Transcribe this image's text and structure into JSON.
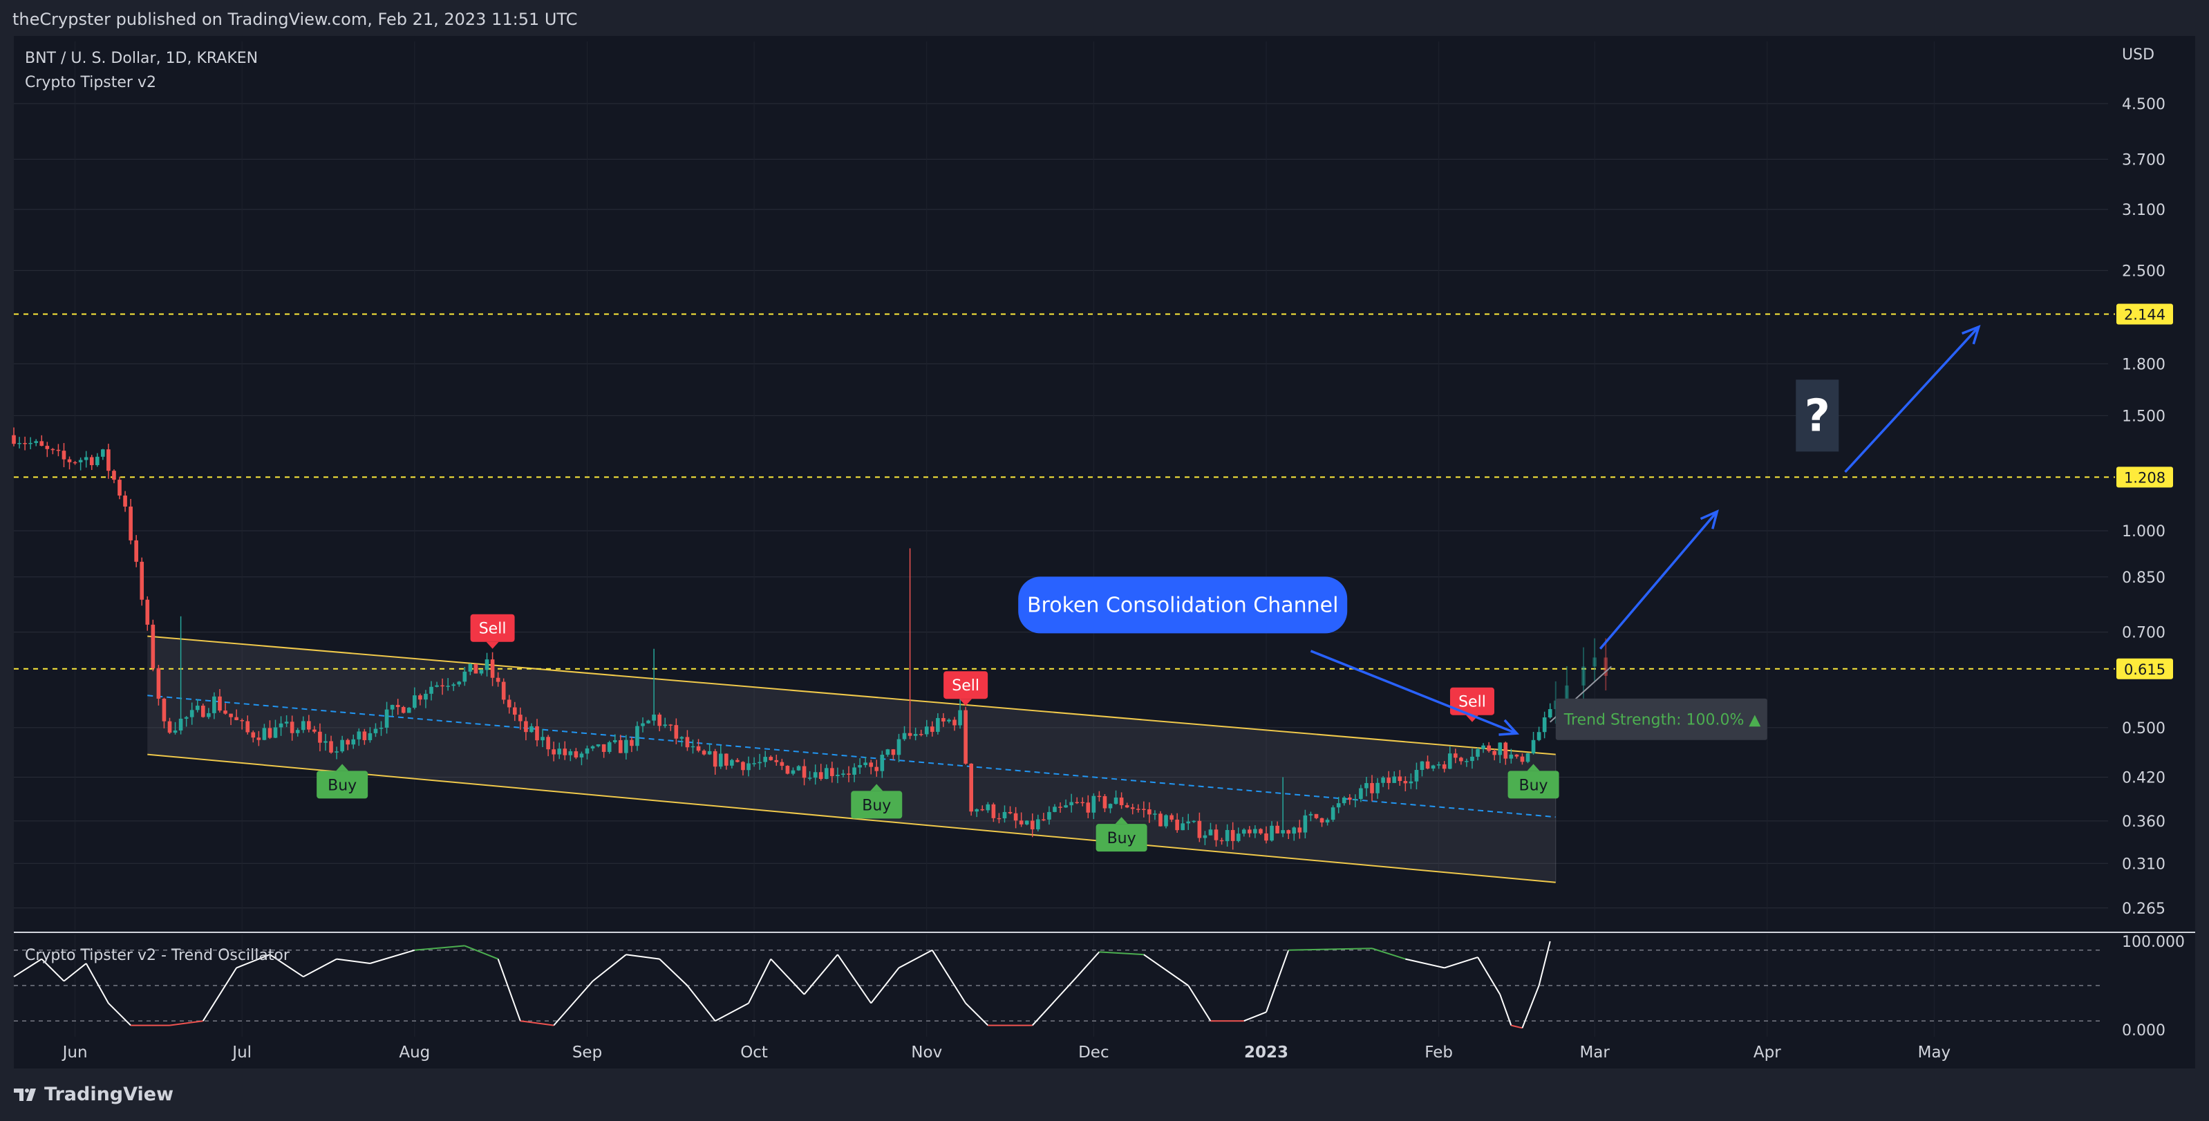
{
  "header": {
    "published_text": "theCrypster published on TradingView.com, Feb 21, 2023 11:51 UTC"
  },
  "footer": {
    "brand": "TradingView"
  },
  "colors": {
    "up": "#26a69a",
    "down": "#ef5350",
    "channel": "#f0c94b",
    "level": "#ffeb3b",
    "arrow": "#2962ff",
    "buy": "#4caf50",
    "sell": "#f23645",
    "osc_up": "#4caf50",
    "osc_down": "#ef5350",
    "osc_mid": "#ffffff"
  },
  "chart_data": {
    "type": "candlestick",
    "symbol_line": "BNT / U. S. Dollar, 1D, KRAKEN",
    "indicator_line": "Crypto Tipster v2",
    "currency": "USD",
    "y_scale": "log",
    "ylim": [
      0.245,
      5.6
    ],
    "y_ticks": [
      "4.500",
      "3.700",
      "3.100",
      "2.500",
      "1.800",
      "1.500",
      "1.000",
      "0.850",
      "0.700",
      "0.500",
      "0.420",
      "0.360",
      "0.310",
      "0.265"
    ],
    "x_ticks": [
      {
        "label": "Jun",
        "date": "2022-06-01"
      },
      {
        "label": "Jul",
        "date": "2022-07-01"
      },
      {
        "label": "Aug",
        "date": "2022-08-01"
      },
      {
        "label": "Sep",
        "date": "2022-09-01"
      },
      {
        "label": "Oct",
        "date": "2022-10-01"
      },
      {
        "label": "Nov",
        "date": "2022-11-01"
      },
      {
        "label": "Dec",
        "date": "2022-12-01"
      },
      {
        "label": "2023",
        "date": "2023-01-01",
        "bold": true
      },
      {
        "label": "Feb",
        "date": "2023-02-01"
      },
      {
        "label": "Mar",
        "date": "2023-03-01"
      },
      {
        "label": "Apr",
        "date": "2023-04-01"
      },
      {
        "label": "May",
        "date": "2023-05-01"
      }
    ],
    "x_range": [
      "2022-05-21",
      "2023-05-31"
    ],
    "price_key_points": [
      [
        "2022-05-21",
        1.4
      ],
      [
        "2022-05-30",
        1.28
      ],
      [
        "2022-06-06",
        1.3
      ],
      [
        "2022-06-10",
        1.1
      ],
      [
        "2022-06-14",
        0.7
      ],
      [
        "2022-06-17",
        0.5
      ],
      [
        "2022-06-22",
        0.52
      ],
      [
        "2022-06-26",
        0.55
      ],
      [
        "2022-07-02",
        0.49
      ],
      [
        "2022-07-12",
        0.5
      ],
      [
        "2022-07-18",
        0.46
      ],
      [
        "2022-07-27",
        0.52
      ],
      [
        "2022-08-04",
        0.58
      ],
      [
        "2022-08-14",
        0.62
      ],
      [
        "2022-08-20",
        0.5
      ],
      [
        "2022-08-29",
        0.45
      ],
      [
        "2022-09-08",
        0.47
      ],
      [
        "2022-09-13",
        0.52
      ],
      [
        "2022-09-21",
        0.45
      ],
      [
        "2022-10-02",
        0.44
      ],
      [
        "2022-10-12",
        0.43
      ],
      [
        "2022-10-22",
        0.43
      ],
      [
        "2022-10-28",
        0.48
      ],
      [
        "2022-11-02",
        0.5
      ],
      [
        "2022-11-07",
        0.52
      ],
      [
        "2022-11-09",
        0.38
      ],
      [
        "2022-11-14",
        0.37
      ],
      [
        "2022-11-19",
        0.35
      ],
      [
        "2022-11-27",
        0.38
      ],
      [
        "2022-12-06",
        0.385
      ],
      [
        "2022-12-14",
        0.36
      ],
      [
        "2022-12-22",
        0.345
      ],
      [
        "2022-12-30",
        0.34
      ],
      [
        "2023-01-03",
        0.345
      ],
      [
        "2023-01-12",
        0.37
      ],
      [
        "2023-01-19",
        0.4
      ],
      [
        "2023-01-31",
        0.44
      ],
      [
        "2023-02-07",
        0.46
      ],
      [
        "2023-02-12",
        0.47
      ],
      [
        "2023-02-15",
        0.44
      ],
      [
        "2023-02-21",
        0.52
      ]
    ],
    "wick_spikes": [
      {
        "date": "2022-06-20",
        "high": 0.74
      },
      {
        "date": "2022-09-13",
        "high": 0.66
      },
      {
        "date": "2022-10-29",
        "high": 0.94
      },
      {
        "date": "2022-11-07",
        "high": 0.56
      },
      {
        "date": "2023-01-04",
        "high": 0.42
      }
    ],
    "projection_candles": [
      [
        "2023-02-22",
        0.55
      ],
      [
        "2023-02-24",
        0.58
      ],
      [
        "2023-02-27",
        0.62
      ],
      [
        "2023-03-01",
        0.64
      ],
      [
        "2023-03-03",
        0.6
      ]
    ],
    "channel": {
      "upper": [
        [
          "2022-06-14",
          0.69
        ],
        [
          "2023-02-22",
          0.455
        ]
      ],
      "lower": [
        [
          "2022-06-14",
          0.455
        ],
        [
          "2023-02-22",
          0.29
        ]
      ],
      "mid": [
        [
          "2022-06-14",
          0.56
        ],
        [
          "2023-02-22",
          0.365
        ]
      ]
    },
    "levels": [
      {
        "value": 2.144,
        "label": "2.144"
      },
      {
        "value": 1.208,
        "label": "1.208"
      },
      {
        "value": 0.615,
        "label": "0.615"
      }
    ],
    "signals": [
      {
        "type": "sell",
        "label": "Sell",
        "date": "2022-08-15",
        "price": 0.66
      },
      {
        "type": "buy",
        "label": "Buy",
        "date": "2022-07-19",
        "price": 0.44
      },
      {
        "type": "sell",
        "label": "Sell",
        "date": "2022-11-08",
        "price": 0.54
      },
      {
        "type": "buy",
        "label": "Buy",
        "date": "2022-10-23",
        "price": 0.41
      },
      {
        "type": "buy",
        "label": "Buy",
        "date": "2022-12-06",
        "price": 0.365
      },
      {
        "type": "sell",
        "label": "Sell",
        "date": "2023-02-07",
        "price": 0.51
      },
      {
        "type": "buy",
        "label": "Buy",
        "date": "2023-02-18",
        "price": 0.44
      }
    ],
    "annotations": {
      "callout_text": "Broken Consolidation Channel",
      "trend_strength_text": "Trend Strength: 100.0% ▲",
      "question_mark": "?",
      "arrows": [
        [
          [
            "2023-01-09",
            0.655
          ],
          [
            "2023-02-15",
            0.49
          ]
        ],
        [
          [
            "2023-03-02",
            0.66
          ],
          [
            "2023-03-23",
            1.07
          ]
        ],
        [
          [
            "2023-04-15",
            1.23
          ],
          [
            "2023-05-09",
            2.05
          ]
        ]
      ]
    },
    "oscillator": {
      "title": "Crypto Tipster v2 - Trend Oscillator",
      "ylim": [
        0,
        100
      ],
      "y_ticks": [
        "100.000",
        "0.000"
      ],
      "band_lines": [
        90,
        50,
        10
      ],
      "key_points": [
        [
          "2022-05-21",
          60
        ],
        [
          "2022-05-26",
          80
        ],
        [
          "2022-05-30",
          55
        ],
        [
          "2022-06-03",
          75
        ],
        [
          "2022-06-07",
          30
        ],
        [
          "2022-06-11",
          5
        ],
        [
          "2022-06-18",
          5
        ],
        [
          "2022-06-24",
          10
        ],
        [
          "2022-06-30",
          70
        ],
        [
          "2022-07-06",
          85
        ],
        [
          "2022-07-12",
          60
        ],
        [
          "2022-07-18",
          80
        ],
        [
          "2022-07-24",
          75
        ],
        [
          "2022-08-01",
          90
        ],
        [
          "2022-08-10",
          95
        ],
        [
          "2022-08-16",
          80
        ],
        [
          "2022-08-20",
          10
        ],
        [
          "2022-08-26",
          5
        ],
        [
          "2022-09-02",
          55
        ],
        [
          "2022-09-08",
          85
        ],
        [
          "2022-09-14",
          80
        ],
        [
          "2022-09-19",
          50
        ],
        [
          "2022-09-24",
          10
        ],
        [
          "2022-09-30",
          30
        ],
        [
          "2022-10-04",
          80
        ],
        [
          "2022-10-10",
          40
        ],
        [
          "2022-10-16",
          85
        ],
        [
          "2022-10-22",
          30
        ],
        [
          "2022-10-27",
          70
        ],
        [
          "2022-11-02",
          90
        ],
        [
          "2022-11-08",
          30
        ],
        [
          "2022-11-12",
          5
        ],
        [
          "2022-11-20",
          5
        ],
        [
          "2022-11-28",
          60
        ],
        [
          "2022-12-02",
          88
        ],
        [
          "2022-12-10",
          85
        ],
        [
          "2022-12-18",
          50
        ],
        [
          "2022-12-22",
          10
        ],
        [
          "2022-12-28",
          10
        ],
        [
          "2023-01-01",
          20
        ],
        [
          "2023-01-05",
          90
        ],
        [
          "2023-01-20",
          92
        ],
        [
          "2023-01-26",
          80
        ],
        [
          "2023-02-02",
          70
        ],
        [
          "2023-02-08",
          82
        ],
        [
          "2023-02-12",
          40
        ],
        [
          "2023-02-14",
          5
        ],
        [
          "2023-02-16",
          2
        ],
        [
          "2023-02-19",
          50
        ],
        [
          "2023-02-21",
          100
        ]
      ]
    }
  }
}
